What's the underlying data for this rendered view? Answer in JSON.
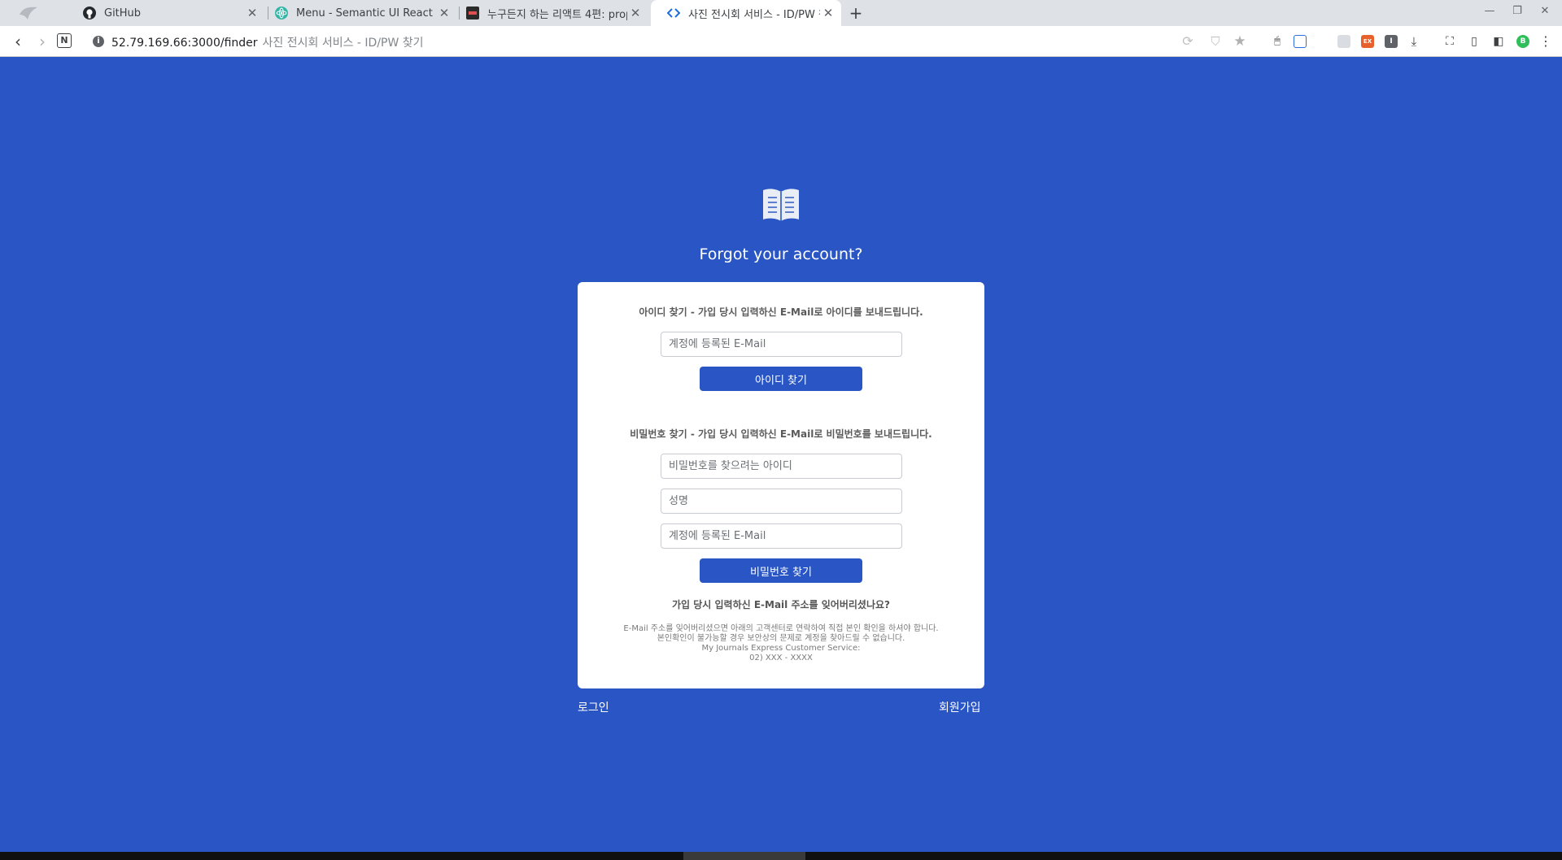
{
  "tabs": [
    {
      "title": "GitHub",
      "icon": "github-icon"
    },
    {
      "title": "Menu - Semantic UI React",
      "icon": "react-icon"
    },
    {
      "title": "누구든지 하는 리액트 4편: prop",
      "icon": "velopert-icon"
    },
    {
      "title": "사진 전시회 서비스 - ID/PW 찾",
      "icon": "code-icon"
    }
  ],
  "address_bar": {
    "url": "52.79.169.66:3000/finder",
    "page_title": "사진 전시회 서비스 - ID/PW 찾기"
  },
  "extensions": [
    {
      "name": "abp",
      "label": "ABP",
      "color": "#c4121b"
    },
    {
      "name": "ex",
      "label": "EX",
      "color": "#e8602b"
    },
    {
      "name": "profile",
      "label": "B",
      "color": "#2fbf5a"
    }
  ],
  "page": {
    "heading": "Forgot your account?",
    "find_id": {
      "title": "아이디 찾기 - 가입 당시 입력하신 E-Mail로 아이디를 보내드립니다.",
      "email_placeholder": "계정에 등록된 E-Mail",
      "button": "아이디 찾기"
    },
    "find_pw": {
      "title": "비밀번호 찾기 - 가입 당시 입력하신 E-Mail로 비밀번호를 보내드립니다.",
      "id_placeholder": "비밀번호를 찾으려는 아이디",
      "name_placeholder": "성명",
      "email_placeholder": "계정에 등록된 E-Mail",
      "button": "비밀번호 찾기"
    },
    "forgot_email": {
      "title": "가입 당시 입력하신 E-Mail 주소를 잊어버리셨나요?",
      "line1": "E-Mail 주소를 잊어버리셨으면 아래의 고객센터로 연락하여 직접 본인 확인을 하셔야 합니다.",
      "line2": "본인확인이 불가능할 경우 보안상의 문제로 계정을 찾아드릴 수 없습니다.",
      "line3": "My Journals Express Customer Service:",
      "line4": "02) XXX - XXXX"
    },
    "login_link": "로그인",
    "signup_link": "회원가입"
  },
  "colors": {
    "background": "#2a55c4",
    "button": "#2a55c4",
    "card": "#ffffff"
  }
}
